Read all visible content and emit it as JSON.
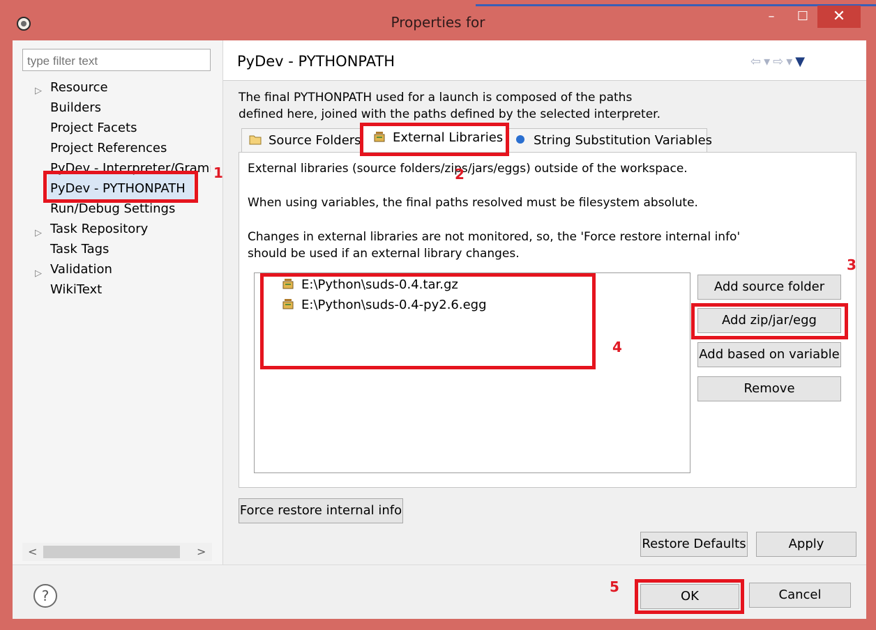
{
  "window": {
    "title": "Properties for",
    "minimize": "–",
    "maximize": "☐",
    "close": "✕"
  },
  "filter": {
    "placeholder": "type filter text"
  },
  "tree": [
    {
      "label": "Resource",
      "expandable": true
    },
    {
      "label": "Builders"
    },
    {
      "label": "Project Facets"
    },
    {
      "label": "Project References"
    },
    {
      "label": "PyDev - Interpreter/Gramm"
    },
    {
      "label": "PyDev - PYTHONPATH",
      "selected": true
    },
    {
      "label": "Run/Debug Settings"
    },
    {
      "label": "Task Repository",
      "expandable": true
    },
    {
      "label": "Task Tags"
    },
    {
      "label": "Validation",
      "expandable": true
    },
    {
      "label": "WikiText"
    }
  ],
  "scroll": {
    "left": "<",
    "right": ">"
  },
  "page": {
    "title": "PyDev - PYTHONPATH",
    "description": [
      "The final PYTHONPATH used for a launch is composed of the paths",
      "defined here, joined with the paths defined by the selected interpreter."
    ],
    "nav_icons": [
      "back-icon",
      "back-menu-icon",
      "forward-icon",
      "forward-menu-icon",
      "view-menu-icon"
    ]
  },
  "tabs": [
    {
      "label": "Source Folders",
      "icon": "folder-icon"
    },
    {
      "label": "External Libraries",
      "icon": "jar-icon",
      "active": true
    },
    {
      "label": "String Substitution Variables",
      "icon": "blue-dot-icon"
    }
  ],
  "panel": {
    "info": [
      "External libraries (source folders/zips/jars/eggs) outside of the workspace.",
      "When using variables, the final paths resolved must be filesystem absolute.",
      "Changes in external libraries are not monitored, so, the 'Force restore internal info'",
      "should be used if an external library changes."
    ],
    "libraries": [
      "E:\\Python\\suds-0.4.tar.gz",
      "E:\\Python\\suds-0.4-py2.6.egg"
    ],
    "buttons": {
      "add_source_folder": "Add source folder",
      "add_zip": "Add zip/jar/egg",
      "add_variable": "Add based on variable",
      "remove": "Remove"
    }
  },
  "force_restore": "Force restore internal info",
  "restore_defaults": "Restore Defaults",
  "apply": "Apply",
  "ok": "OK",
  "cancel": "Cancel",
  "help": "?",
  "annotations": [
    "1",
    "2",
    "3",
    "4",
    "5"
  ],
  "colors": {
    "window_frame": "#d66a63",
    "annotation_red": "#e5141e",
    "selection": "#d9e6f5"
  }
}
